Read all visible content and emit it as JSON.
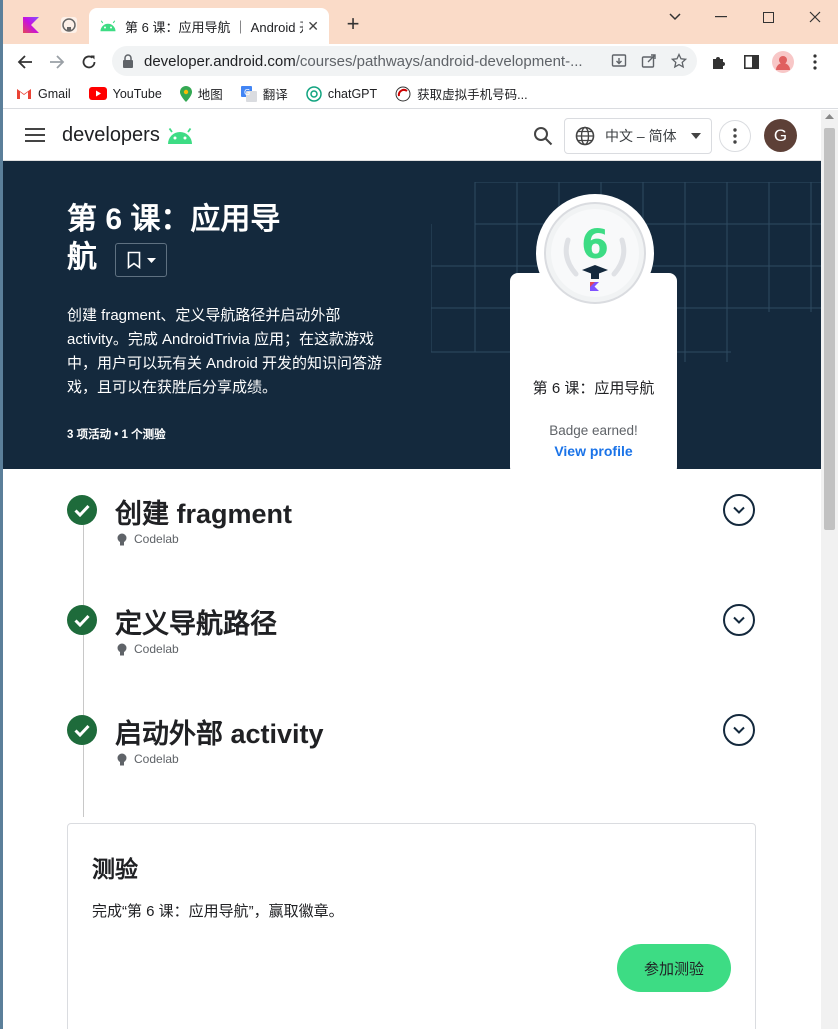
{
  "browser": {
    "tab_title": "第 6 课：应用导航 ｜ Android 开",
    "url_host": "developer.android.com",
    "url_path": "/courses/pathways/android-development-...",
    "bookmarks": [
      "Gmail",
      "YouTube",
      "地图",
      "翻译",
      "chatGPT",
      "获取虚拟手机号码..."
    ]
  },
  "site": {
    "logo_text": "developers",
    "language": "中文 – 简体",
    "avatar_initial": "G"
  },
  "hero": {
    "title": "第 6 课：应用导航",
    "description": "创建 fragment、定义导航路径并启动外部 activity。完成 AndroidTrivia 应用；在这款游戏中，用户可以玩有关 Android 开发的知识问答游戏，且可以在获胜后分享成绩。",
    "meta": "3 项活动 • 1 个测验"
  },
  "badge": {
    "number": "6",
    "title": "第 6 课：应用导航",
    "earned": "Badge earned!",
    "view_profile": "View profile"
  },
  "steps": [
    {
      "title": "创建 fragment",
      "type": "Codelab"
    },
    {
      "title": "定义导航路径",
      "type": "Codelab"
    },
    {
      "title": "启动外部 activity",
      "type": "Codelab"
    }
  ],
  "quiz": {
    "title": "测验",
    "description": "完成“第 6 课：应用导航”，赢取徽章。",
    "button": "参加测验"
  },
  "colors": {
    "hero_bg": "#14293d",
    "check_green": "#1e6b3b",
    "android_green": "#3ddc84",
    "link_blue": "#1a73e8"
  },
  "icons": [
    "kotlin-icon",
    "github-icon",
    "android-icon",
    "close-icon",
    "plus-icon",
    "back-icon",
    "forward-icon",
    "reload-icon",
    "lock-icon",
    "install-icon",
    "share-icon",
    "star-icon",
    "extension-icon",
    "sidepanel-icon",
    "profile-icon",
    "more-vert-icon",
    "menu-icon",
    "search-icon",
    "globe-icon",
    "bookmark-icon",
    "check-icon",
    "chevron-down-icon",
    "lightbulb-icon"
  ]
}
